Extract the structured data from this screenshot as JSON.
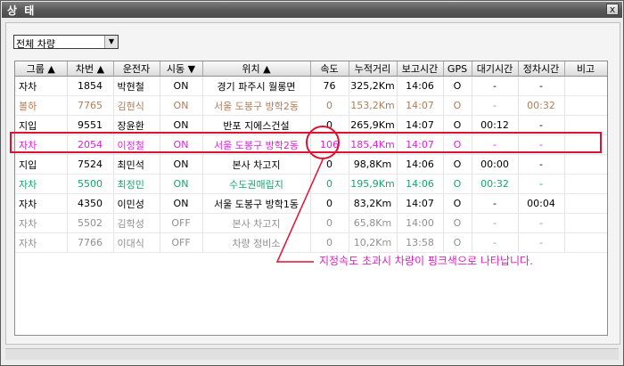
{
  "window": {
    "title": "상 태",
    "close_glyph": "x"
  },
  "filter": {
    "selected": "전체 차량"
  },
  "table": {
    "headers": [
      "그룹 ▲",
      "차번 ▲",
      "운전자",
      "시동 ▼",
      "위치 ▲",
      "속도",
      "누적거리",
      "보고시간",
      "GPS",
      "대기시간",
      "정차시간",
      "비고"
    ],
    "rows": [
      {
        "style": "normal",
        "cells": [
          "자차",
          "1854",
          "박현철",
          "ON",
          "경기 파주시 월롱면",
          "76",
          "325,2Km",
          "14:06",
          "O",
          "-",
          "-",
          ""
        ]
      },
      {
        "style": "brown",
        "cells": [
          "볼하",
          "7765",
          "김현식",
          "ON",
          "서울 도봉구 방학2동",
          "0",
          "153,2Km",
          "14:07",
          "O",
          "-",
          "00:32",
          ""
        ]
      },
      {
        "style": "normal",
        "cells": [
          "지입",
          "9551",
          "장윤환",
          "ON",
          "반포 지에스건설",
          "0",
          "265,9Km",
          "14:07",
          "O",
          "00:12",
          "-",
          ""
        ]
      },
      {
        "style": "magenta",
        "cells": [
          "자차",
          "2054",
          "이정철",
          "ON",
          "서울 도봉구 방학2동",
          "106",
          "185,4Km",
          "14:07",
          "O",
          "-",
          "-",
          ""
        ]
      },
      {
        "style": "normal",
        "cells": [
          "지입",
          "7524",
          "최민석",
          "ON",
          "본사 차고지",
          "0",
          "98,8Km",
          "14:06",
          "O",
          "00:00",
          "-",
          ""
        ]
      },
      {
        "style": "green",
        "cells": [
          "자차",
          "5500",
          "최정민",
          "ON",
          "수도권매립지",
          "0",
          "195,9Km",
          "14:06",
          "O",
          "00:32",
          "-",
          ""
        ]
      },
      {
        "style": "normal",
        "cells": [
          "자차",
          "4350",
          "이민성",
          "ON",
          "서울 도봉구 방학1동",
          "0",
          "83,2Km",
          "14:07",
          "O",
          "-",
          "00:04",
          ""
        ]
      },
      {
        "style": "gray",
        "cells": [
          "자차",
          "5502",
          "김학성",
          "OFF",
          "본사 차고지",
          "0",
          "65,8Km",
          "14:00",
          "O",
          "-",
          "-",
          ""
        ]
      },
      {
        "style": "gray",
        "cells": [
          "자차",
          "7766",
          "이대식",
          "OFF",
          "차량 정비소",
          "0",
          "10,2Km",
          "13:58",
          "O",
          "-",
          "-",
          ""
        ]
      }
    ]
  },
  "annotation": {
    "note": "지정속도 초과시 차량이 핑크색으로 나타납니다.",
    "color": "#e01030"
  }
}
